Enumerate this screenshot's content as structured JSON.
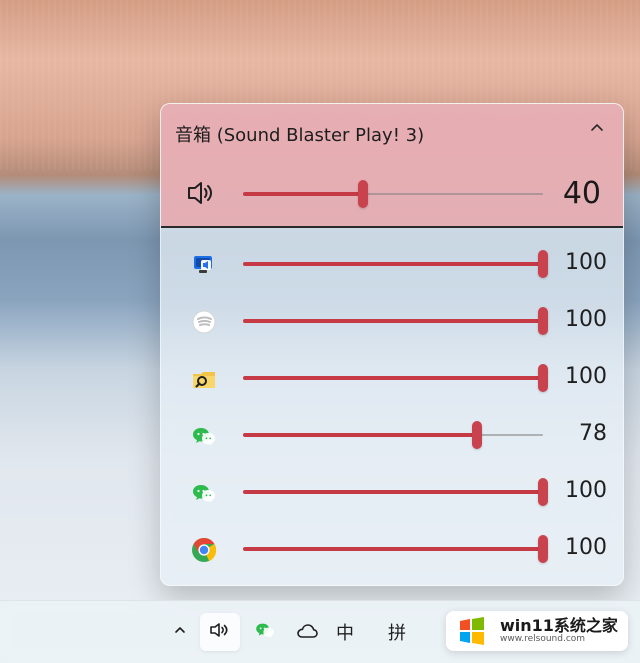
{
  "flyout": {
    "device": {
      "name": "音箱 (Sound Blaster Play! 3)",
      "volume_value": "40",
      "volume_level": 0.4,
      "icons": {
        "collapse": "chevron-up-icon",
        "speaker": "speaker-volume-icon"
      }
    },
    "apps": [
      {
        "name": "System sounds",
        "icon": "monitor-speaker-icon",
        "value": "100",
        "level": 1.0
      },
      {
        "name": "Spotify",
        "icon": "spotify-icon",
        "value": "100",
        "level": 1.0
      },
      {
        "name": "File Explorer",
        "icon": "folder-search-icon",
        "value": "100",
        "level": 1.0
      },
      {
        "name": "WeChat",
        "icon": "wechat-icon",
        "value": "78",
        "level": 0.78
      },
      {
        "name": "WeChat",
        "icon": "wechat-icon",
        "value": "100",
        "level": 1.0
      },
      {
        "name": "Google Chrome",
        "icon": "chrome-icon",
        "value": "100",
        "level": 1.0
      }
    ],
    "colors": {
      "accent": "#c63a46",
      "thumb": "#c9434e"
    }
  },
  "taskbar": {
    "items": [
      {
        "icon": "chevron-up-icon",
        "label": "^"
      },
      {
        "icon": "speaker-volume-icon",
        "label": ""
      },
      {
        "icon": "wechat-icon",
        "label": ""
      },
      {
        "icon": "cloud-icon",
        "label": ""
      },
      {
        "label": "中"
      },
      {
        "label": "拼"
      }
    ]
  },
  "watermark": {
    "text_main": "win11系统之家",
    "text_sub": "www.relsound.com"
  }
}
